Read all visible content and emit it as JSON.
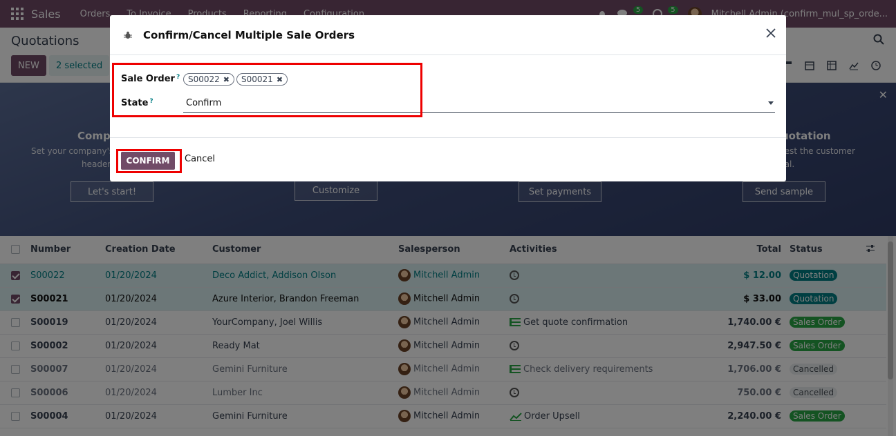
{
  "navbar": {
    "brand": "Sales",
    "menu": [
      "Orders",
      "To Invoice",
      "Products",
      "Reporting",
      "Configuration"
    ],
    "chat_count": "5",
    "activity_count": "5",
    "user": "Mitchell Admin (confirm_mul_sp_orde..."
  },
  "control": {
    "breadcrumb": "Quotations",
    "new_label": "NEW",
    "selected_label": "2 selected"
  },
  "banner": {
    "steps": [
      {
        "title": "Compa",
        "desc1": "Set your company's",
        "desc2": "header",
        "button": "Let's start!"
      },
      {
        "button": "Customize"
      },
      {
        "button": "Set payments"
      },
      {
        "title": "uotation",
        "desc1": "test the customer",
        "desc2": "tal.",
        "button": "Send sample"
      }
    ]
  },
  "table": {
    "headers": [
      "Number",
      "Creation Date",
      "Customer",
      "Salesperson",
      "Activities",
      "Total",
      "Status"
    ],
    "rows": [
      {
        "number": "S00022",
        "date": "01/20/2024",
        "customer": "Deco Addict, Addison Olson",
        "salesperson": "Mitchell Admin",
        "activity": "",
        "activity_icon": "clock",
        "total": "$ 12.00",
        "status": "Quotation"
      },
      {
        "number": "S00021",
        "date": "01/20/2024",
        "customer": "Azure Interior, Brandon Freeman",
        "salesperson": "Mitchell Admin",
        "activity": "",
        "activity_icon": "clock",
        "total": "$ 33.00",
        "status": "Quotation"
      },
      {
        "number": "S00019",
        "date": "01/20/2024",
        "customer": "YourCompany, Joel Willis",
        "salesperson": "Mitchell Admin",
        "activity": "Get quote confirmation",
        "activity_icon": "todo",
        "total": "1,740.00 €",
        "status": "Sales Order"
      },
      {
        "number": "S00002",
        "date": "01/20/2024",
        "customer": "Ready Mat",
        "salesperson": "Mitchell Admin",
        "activity": "",
        "activity_icon": "clock",
        "total": "2,947.50 €",
        "status": "Sales Order"
      },
      {
        "number": "S00007",
        "date": "01/20/2024",
        "customer": "Gemini Furniture",
        "salesperson": "Mitchell Admin",
        "activity": "Check delivery requirements",
        "activity_icon": "todo",
        "total": "1,706.00 €",
        "status": "Cancelled"
      },
      {
        "number": "S00006",
        "date": "01/20/2024",
        "customer": "Lumber Inc",
        "salesperson": "Mitchell Admin",
        "activity": "",
        "activity_icon": "clock",
        "total": "750.00 €",
        "status": "Cancelled"
      },
      {
        "number": "S00004",
        "date": "01/20/2024",
        "customer": "Gemini Furniture",
        "salesperson": "Mitchell Admin",
        "activity": "Order Upsell",
        "activity_icon": "chart",
        "total": "2,240.00 €",
        "status": "Sales Order"
      }
    ]
  },
  "modal": {
    "title": "Confirm/Cancel Multiple Sale Orders",
    "sale_order_label": "Sale Order",
    "state_label": "State",
    "help_mark": "?",
    "tags": [
      "S00022",
      "S00021"
    ],
    "state_value": "Confirm",
    "confirm_label": "CONFIRM",
    "cancel_label": "Cancel"
  },
  "colors": {
    "brand": "#714B67",
    "accent": "#017e84",
    "highlight": "#e00000"
  }
}
